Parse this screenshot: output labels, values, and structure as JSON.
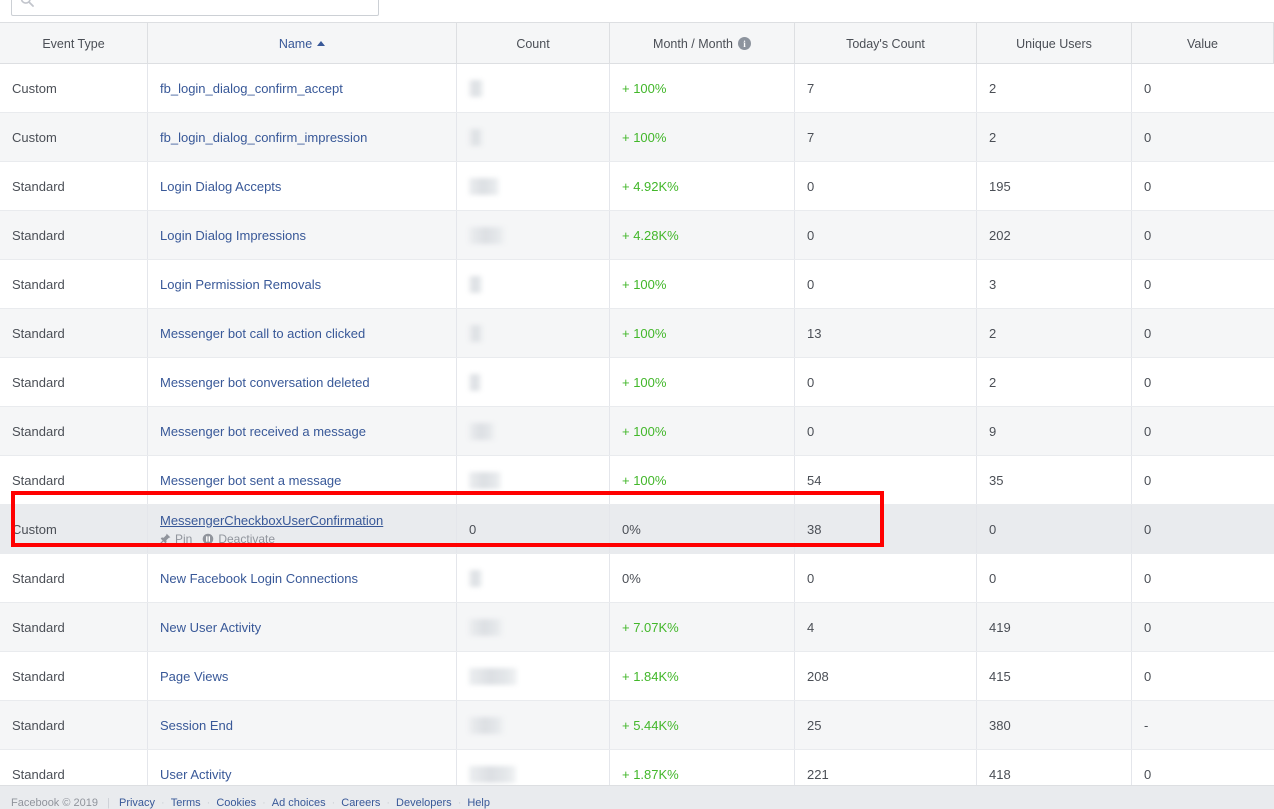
{
  "search": {
    "placeholder": "",
    "value": "",
    "icon": "search-icon"
  },
  "table": {
    "columns": [
      {
        "key": "event_type",
        "label": "Event Type",
        "sortable": true,
        "sorted": false
      },
      {
        "key": "name",
        "label": "Name",
        "sortable": true,
        "sorted": true,
        "sort_dir": "asc"
      },
      {
        "key": "count",
        "label": "Count",
        "sortable": true,
        "sorted": false
      },
      {
        "key": "mom",
        "label": "Month / Month",
        "sortable": true,
        "sorted": false,
        "info": true
      },
      {
        "key": "todays_count",
        "label": "Today's Count",
        "sortable": true,
        "sorted": false
      },
      {
        "key": "unique_users",
        "label": "Unique Users",
        "sortable": true,
        "sorted": false
      },
      {
        "key": "value",
        "label": "Value",
        "sortable": true,
        "sorted": false
      }
    ],
    "row_actions": {
      "pin_label": "Pin",
      "pin_icon": "pin-icon",
      "deactivate_label": "Deactivate",
      "deactivate_icon": "pause-icon"
    },
    "rows": [
      {
        "event_type": "Custom",
        "name": "fb_login_dialog_confirm_accept",
        "count": "",
        "count_bar_width": 14,
        "mom": "+ 100%",
        "mom_state": "up",
        "todays_count": "7",
        "unique_users": "2",
        "value": "0"
      },
      {
        "event_type": "Custom",
        "name": "fb_login_dialog_confirm_impression",
        "count": "",
        "count_bar_width": 14,
        "mom": "+ 100%",
        "mom_state": "up",
        "todays_count": "7",
        "unique_users": "2",
        "value": "0"
      },
      {
        "event_type": "Standard",
        "name": "Login Dialog Accepts",
        "count": "",
        "count_bar_width": 30,
        "mom": "+ 4.92K%",
        "mom_state": "up",
        "todays_count": "0",
        "unique_users": "195",
        "value": "0"
      },
      {
        "event_type": "Standard",
        "name": "Login Dialog Impressions",
        "count": "",
        "count_bar_width": 36,
        "mom": "+ 4.28K%",
        "mom_state": "up",
        "todays_count": "0",
        "unique_users": "202",
        "value": "0"
      },
      {
        "event_type": "Standard",
        "name": "Login Permission Removals",
        "count": "",
        "count_bar_width": 13,
        "mom": "+ 100%",
        "mom_state": "up",
        "todays_count": "0",
        "unique_users": "3",
        "value": "0"
      },
      {
        "event_type": "Standard",
        "name": "Messenger bot call to action clicked",
        "count": "",
        "count_bar_width": 14,
        "mom": "+ 100%",
        "mom_state": "up",
        "todays_count": "13",
        "unique_users": "2",
        "value": "0"
      },
      {
        "event_type": "Standard",
        "name": "Messenger bot conversation deleted",
        "count": "",
        "count_bar_width": 12,
        "mom": "+ 100%",
        "mom_state": "up",
        "todays_count": "0",
        "unique_users": "2",
        "value": "0"
      },
      {
        "event_type": "Standard",
        "name": "Messenger bot received a message",
        "count": "",
        "count_bar_width": 26,
        "mom": "+ 100%",
        "mom_state": "up",
        "todays_count": "0",
        "unique_users": "9",
        "value": "0"
      },
      {
        "event_type": "Standard",
        "name": "Messenger bot sent a message",
        "count": "",
        "count_bar_width": 32,
        "mom": "+ 100%",
        "mom_state": "up",
        "todays_count": "54",
        "unique_users": "35",
        "value": "0"
      },
      {
        "event_type": "Custom",
        "name": "MessengerCheckboxUserConfirmation",
        "count": "0",
        "count_bar_width": 0,
        "mom": "0%",
        "mom_state": "flat",
        "todays_count": "38",
        "unique_users": "0",
        "value": "0",
        "highlighted": true,
        "has_actions": true
      },
      {
        "event_type": "Standard",
        "name": "New Facebook Login Connections",
        "count": "",
        "count_bar_width": 13,
        "mom": "0%",
        "mom_state": "flat",
        "todays_count": "0",
        "unique_users": "0",
        "value": "0"
      },
      {
        "event_type": "Standard",
        "name": "New User Activity",
        "count": "",
        "count_bar_width": 34,
        "mom": "+ 7.07K%",
        "mom_state": "up",
        "todays_count": "4",
        "unique_users": "419",
        "value": "0"
      },
      {
        "event_type": "Standard",
        "name": "Page Views",
        "count": "",
        "count_bar_width": 48,
        "mom": "+ 1.84K%",
        "mom_state": "up",
        "todays_count": "208",
        "unique_users": "415",
        "value": "0"
      },
      {
        "event_type": "Standard",
        "name": "Session End",
        "count": "",
        "count_bar_width": 35,
        "mom": "+ 5.44K%",
        "mom_state": "up",
        "todays_count": "25",
        "unique_users": "380",
        "value": "-"
      },
      {
        "event_type": "Standard",
        "name": "User Activity",
        "count": "",
        "count_bar_width": 47,
        "mom": "+ 1.87K%",
        "mom_state": "up",
        "todays_count": "221",
        "unique_users": "418",
        "value": "0"
      }
    ]
  },
  "annotation": {
    "type": "red-highlight-box",
    "color": "#ff0000",
    "targets_row_name": "MessengerCheckboxUserConfirmation"
  },
  "footer": {
    "copyright": "Facebook © 2019",
    "links": [
      "Privacy",
      "Terms",
      "Cookies",
      "Ad choices",
      "Careers",
      "Developers",
      "Help"
    ]
  },
  "colors": {
    "link": "#385898",
    "positive": "#42b72a",
    "header_bg": "#f5f6f7",
    "alt_row_bg": "#f5f6f7",
    "highlight_row_bg": "#e9ebee",
    "annotation": "#ff0000",
    "text": "#4b4f56"
  }
}
